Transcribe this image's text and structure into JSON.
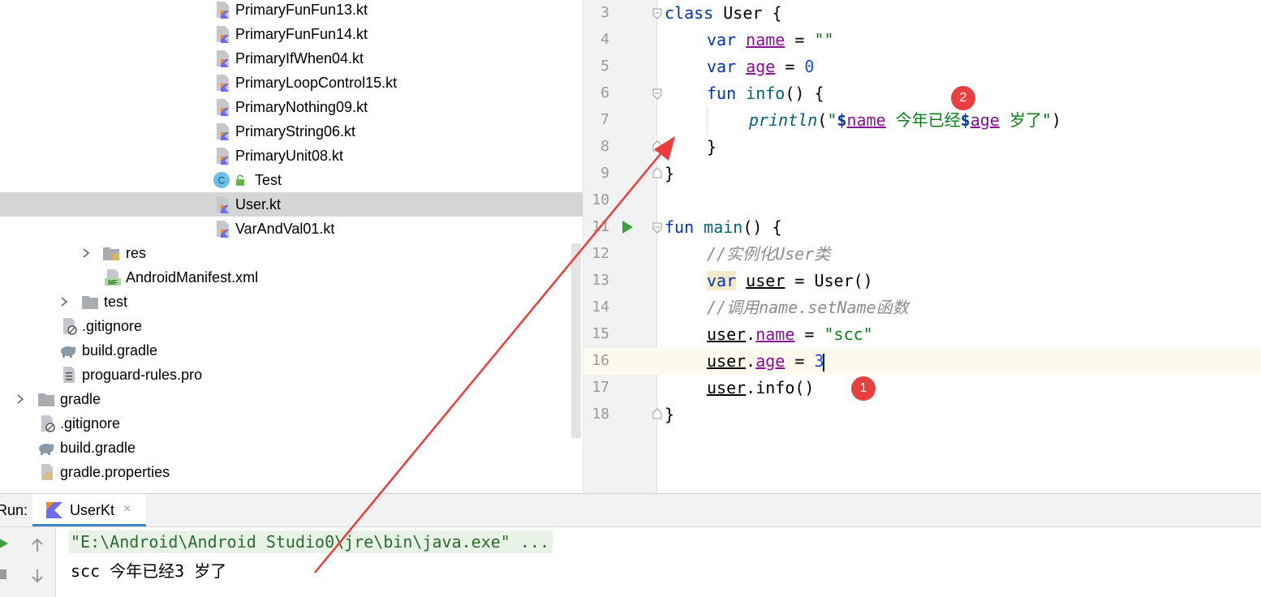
{
  "project_tree": {
    "items": [
      {
        "label": "PrimaryFunFun13.kt",
        "icon": "kotlin-file-icon"
      },
      {
        "label": "PrimaryFunFun14.kt",
        "icon": "kotlin-file-icon"
      },
      {
        "label": "PrimaryIfWhen04.kt",
        "icon": "kotlin-file-icon"
      },
      {
        "label": "PrimaryLoopControl15.kt",
        "icon": "kotlin-file-icon"
      },
      {
        "label": "PrimaryNothing09.kt",
        "icon": "kotlin-file-icon"
      },
      {
        "label": "PrimaryString06.kt",
        "icon": "kotlin-file-icon"
      },
      {
        "label": "PrimaryUnit08.kt",
        "icon": "kotlin-file-icon"
      },
      {
        "label": "Test",
        "icon": "class-icon"
      },
      {
        "label": "User.kt",
        "icon": "kotlin-file-icon",
        "selected": true
      },
      {
        "label": "VarAndVal01.kt",
        "icon": "kotlin-file-icon"
      },
      {
        "label": "res",
        "icon": "resource-folder-icon"
      },
      {
        "label": "AndroidManifest.xml",
        "icon": "manifest-icon"
      },
      {
        "label": "test",
        "icon": "folder-icon"
      },
      {
        "label": ".gitignore",
        "icon": "ignore-file-icon"
      },
      {
        "label": "build.gradle",
        "icon": "gradle-icon"
      },
      {
        "label": "proguard-rules.pro",
        "icon": "text-file-icon"
      },
      {
        "label": "gradle",
        "icon": "folder-icon"
      },
      {
        "label": ".gitignore",
        "icon": "ignore-file-icon"
      },
      {
        "label": "build.gradle",
        "icon": "gradle-icon"
      },
      {
        "label": "gradle.properties",
        "icon": "properties-icon"
      }
    ]
  },
  "editor": {
    "line_numbers": [
      "3",
      "4",
      "5",
      "6",
      "7",
      "8",
      "9",
      "10",
      "11",
      "12",
      "13",
      "14",
      "15",
      "16",
      "17",
      "18"
    ],
    "code": {
      "l3_kw": "class",
      "l3_rest": " User {",
      "l4_kw": "var",
      "l4_prop": "name",
      "l4_op": " = ",
      "l4_str": "\"\"",
      "l5_kw": "var",
      "l5_prop": "age",
      "l5_op": " = ",
      "l5_num": "0",
      "l6_kw": "fun",
      "l6_fn": "info",
      "l6_rest": "() {",
      "l7_fn": "println",
      "l7_p1": "(",
      "l7_q1": "\"",
      "l7_d1": "$",
      "l7_v1": "name",
      "l7_txt": " 今年已经",
      "l7_d2": "$",
      "l7_v2": "age",
      "l7_txt2": " 岁了",
      "l7_q2": "\"",
      "l7_p2": ")",
      "l8": "}",
      "l9": "}",
      "l11_kw": "fun",
      "l11_fn": "main",
      "l11_rest": "() {",
      "l12_cmt": "//实例化User类",
      "l13_kw": "var",
      "l13_var": "user",
      "l13_rest": " = User()",
      "l14_cmt": "//调用name.setName函数",
      "l15_obj": "user",
      "l15_dot": ".",
      "l15_prop": "name",
      "l15_op": " = ",
      "l15_str": "\"scc\"",
      "l16_obj": "user",
      "l16_dot": ".",
      "l16_prop": "age",
      "l16_op": " = ",
      "l16_num": "3",
      "l17_obj": "user",
      "l17_rest": ".info()",
      "l18": "}"
    },
    "badges": {
      "one": "1",
      "two": "2"
    }
  },
  "run_panel": {
    "label": "Run:",
    "tab_label": "UserKt",
    "tab_close": "×",
    "console": {
      "command": "\"E:\\Android\\Android Studio0\\jre\\bin\\java.exe\" ...",
      "output": "scc 今年已经3 岁了"
    }
  },
  "colors": {
    "keyword": "#0033b3",
    "property": "#871094",
    "string": "#067d17",
    "number": "#1750eb",
    "annotation": "#e84040"
  }
}
